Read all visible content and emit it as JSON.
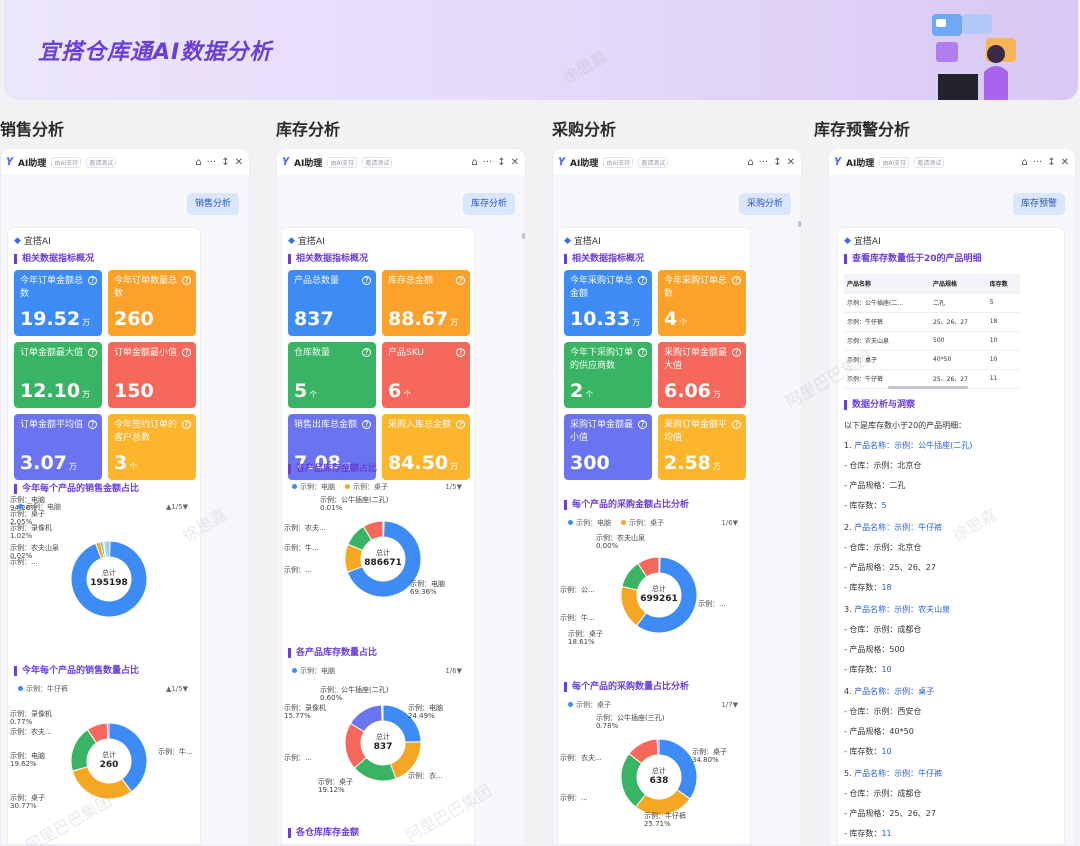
{
  "banner": {
    "title": "宜搭仓库通AI数据分析"
  },
  "watermarks": [
    "徐思嘉",
    "阿里巴巴集团"
  ],
  "assistant": {
    "name": "AI助理",
    "tag1": "由AI支持",
    "tag2": "邀请测试",
    "brand": "宜搭AI"
  },
  "sales": {
    "section_title": "销售分析",
    "prompt": "销售分析",
    "heading": "相关数据指标概况",
    "tiles": [
      {
        "label": "今年订单金额总数",
        "value": "19.52",
        "unit": "万",
        "color": "blue"
      },
      {
        "label": "今年订单数量总数",
        "value": "260",
        "unit": "",
        "color": "orange"
      },
      {
        "label": "订单金额最大值",
        "value": "12.10",
        "unit": "万",
        "color": "green"
      },
      {
        "label": "订单金额最小值",
        "value": "150",
        "unit": "",
        "color": "red"
      },
      {
        "label": "订单金额平均值",
        "value": "3.07",
        "unit": "万",
        "color": "purple"
      },
      {
        "label": "今年签约订单的客户总数",
        "value": "3",
        "unit": "个",
        "color": "amber"
      }
    ],
    "chart1": {
      "title": "今年每个产品的销售金额占比",
      "legend": "示例：电脑",
      "pager": "▲1/5▼",
      "center_label": "总计",
      "center_value": "195198"
    },
    "chart2": {
      "title": "今年每个产品的销售数量占比",
      "legend": "示例：牛仔裤",
      "pager": "▲1/5▼",
      "center_label": "总计",
      "center_value": "260"
    }
  },
  "inventory": {
    "section_title": "库存分析",
    "prompt": "库存分析",
    "heading": "相关数据指标概况",
    "tiles": [
      {
        "label": "产品总数量",
        "value": "837",
        "unit": "",
        "color": "blue"
      },
      {
        "label": "库存总金额",
        "value": "88.67",
        "unit": "万",
        "color": "orange"
      },
      {
        "label": "仓库数量",
        "value": "5",
        "unit": "个",
        "color": "green"
      },
      {
        "label": "产品SKU",
        "value": "6",
        "unit": "个",
        "color": "red"
      },
      {
        "label": "销售出库总金额",
        "value": "7.08",
        "unit": "万",
        "color": "purple"
      },
      {
        "label": "采购入库总金额",
        "value": "84.50",
        "unit": "万",
        "color": "amber"
      }
    ],
    "chart1": {
      "title": "各产品库存金额占比",
      "legend1": "示例：电脑",
      "legend2": "示例：桌子",
      "pager": "1/5▼",
      "center_label": "总计",
      "center_value": "886671"
    },
    "chart2": {
      "title": "各产品库存数量占比",
      "legend": "示例：电脑",
      "pager": "1/6▼",
      "center_label": "总计",
      "center_value": "837"
    },
    "chart3": {
      "title": "各仓库库存金额"
    }
  },
  "purchase": {
    "section_title": "采购分析",
    "prompt": "采购分析",
    "heading": "相关数据指标概况",
    "tiles": [
      {
        "label": "今年采购订单总金额",
        "value": "10.33",
        "unit": "万",
        "color": "blue"
      },
      {
        "label": "今年采购订单总数",
        "value": "4",
        "unit": "个",
        "color": "orange"
      },
      {
        "label": "今年下采购订单的供应商数",
        "value": "2",
        "unit": "个",
        "color": "green"
      },
      {
        "label": "采购订单金额最大值",
        "value": "6.06",
        "unit": "万",
        "color": "red"
      },
      {
        "label": "采购订单金额最小值",
        "value": "300",
        "unit": "",
        "color": "purple"
      },
      {
        "label": "采购订单金额平均值",
        "value": "2.58",
        "unit": "万",
        "color": "amber"
      }
    ],
    "chart1": {
      "title": "每个产品的采购金额占比分析",
      "legend1": "示例：电脑",
      "legend2": "示例：桌子",
      "pager": "1/6▼",
      "center_label": "总计",
      "center_value": "699261"
    },
    "chart2": {
      "title": "每个产品的采购数量占比分析",
      "legend": "示例：桌子",
      "pager": "1/7▼",
      "center_label": "总计",
      "center_value": "638"
    }
  },
  "alert": {
    "section_title": "库存预警分析",
    "prompt": "库存预警",
    "heading1": "查看库存数量低于20的产品明细",
    "columns": [
      "产品名称",
      "产品规格",
      "库存数"
    ],
    "rows": [
      [
        "示例：公牛插座(二...",
        "二孔",
        "5"
      ],
      [
        "示例：牛仔裤",
        "25、26、27",
        "18"
      ],
      [
        "示例：农夫山泉",
        "500",
        "10"
      ],
      [
        "示例：桌子",
        "40*50",
        "10"
      ],
      [
        "示例：牛仔裤",
        "25、26、27",
        "11"
      ]
    ],
    "heading2": "数据分析与洞察",
    "intro": "以下是库存数小于20的产品明细：",
    "items": [
      {
        "n": "1.",
        "name": "产品名称：示例：公牛插座(二孔)",
        "wh": "- 仓库：示例：北京仓",
        "spec": "- 产品规格：二孔",
        "qtyl": "- 库存数：",
        "qty": "5"
      },
      {
        "n": "2.",
        "name": "产品名称：示例：牛仔裤",
        "wh": "- 仓库：示例：北京仓",
        "spec": "- 产品规格：25、26、27",
        "qtyl": "- 库存数：",
        "qty": "18"
      },
      {
        "n": "3.",
        "name": "产品名称：示例：农夫山泉",
        "wh": "- 仓库：示例：成都仓",
        "spec": "- 产品规格：500",
        "qtyl": "- 库存数：",
        "qty": "10"
      },
      {
        "n": "4.",
        "name": "产品名称：示例：桌子",
        "wh": "- 仓库：示例：西安仓",
        "spec": "- 产品规格：40*50",
        "qtyl": "- 库存数：",
        "qty": "10"
      },
      {
        "n": "5.",
        "name": "产品名称：示例：牛仔裤",
        "wh": "- 仓库：示例：成都仓",
        "spec": "- 产品规格：25、26、27",
        "qtyl": "- 库存数：",
        "qty": "11"
      }
    ]
  },
  "donuts": {
    "s1": {
      "parts": [
        {
          "v": 94.26,
          "c": "#3d8bf5",
          "name": "示例：电脑",
          "pct": "94.26%"
        },
        {
          "v": 2.05,
          "c": "#f5a623",
          "name": "示例：桌子",
          "pct": "2.05%"
        },
        {
          "v": 1.02,
          "c": "#39b464",
          "name": "示例：录像机",
          "pct": "1.02%"
        },
        {
          "v": 0.02,
          "c": "#f5685b",
          "name": "示例：农夫山泉",
          "pct": "0.02%"
        },
        {
          "v": 2.65,
          "c": "#9bd0f0",
          "name": "示例：...",
          "pct": ""
        }
      ]
    },
    "s2": {
      "parts": [
        {
          "v": 40.0,
          "c": "#3d8bf5",
          "name": "示例：牛...",
          "pct": ""
        },
        {
          "v": 30.77,
          "c": "#f5a623",
          "name": "示例：桌子",
          "pct": "30.77%"
        },
        {
          "v": 19.62,
          "c": "#39b464",
          "name": "示例：电脑",
          "pct": "19.62%"
        },
        {
          "v": 8.84,
          "c": "#f5685b",
          "name": "示例：农夫...",
          "pct": ""
        },
        {
          "v": 0.77,
          "c": "#6a74f0",
          "name": "示例：录像机",
          "pct": "0.77%"
        }
      ]
    },
    "i1": {
      "parts": [
        {
          "v": 69.36,
          "c": "#3d8bf5",
          "name": "示例：电脑",
          "pct": "69.36%"
        },
        {
          "v": 12.0,
          "c": "#f5a623",
          "name": "示例：...",
          "pct": ""
        },
        {
          "v": 10.0,
          "c": "#39b464",
          "name": "示例：牛...",
          "pct": ""
        },
        {
          "v": 8.63,
          "c": "#f5685b",
          "name": "示例：农夫...",
          "pct": ""
        },
        {
          "v": 0.01,
          "c": "#6a74f0",
          "name": "示例：公牛插座(二孔)",
          "pct": "0.01%"
        }
      ]
    },
    "i2": {
      "parts": [
        {
          "v": 24.49,
          "c": "#3d8bf5",
          "name": "示例：电脑",
          "pct": "24.49%"
        },
        {
          "v": 20.0,
          "c": "#f5a623",
          "name": "示例：衣...",
          "pct": ""
        },
        {
          "v": 19.12,
          "c": "#39b464",
          "name": "示例：桌子",
          "pct": "19.12%"
        },
        {
          "v": 20.04,
          "c": "#f5685b",
          "name": "示例：...",
          "pct": ""
        },
        {
          "v": 15.77,
          "c": "#6a74f0",
          "name": "示例：录像机",
          "pct": "15.77%"
        },
        {
          "v": 0.6,
          "c": "#9bd0f0",
          "name": "示例：公牛插座(二孔)",
          "pct": "0.60%"
        }
      ]
    },
    "p1": {
      "parts": [
        {
          "v": 60.0,
          "c": "#3d8bf5",
          "name": "示例：...",
          "pct": ""
        },
        {
          "v": 18.61,
          "c": "#f5a623",
          "name": "示例：桌子",
          "pct": "18.61%"
        },
        {
          "v": 12.0,
          "c": "#39b464",
          "name": "示例：牛...",
          "pct": ""
        },
        {
          "v": 9.39,
          "c": "#f5685b",
          "name": "示例：公...",
          "pct": ""
        },
        {
          "v": 0.01,
          "c": "#6a74f0",
          "name": "示例：农夫山泉",
          "pct": "0.00%"
        }
      ]
    },
    "p2": {
      "parts": [
        {
          "v": 34.8,
          "c": "#3d8bf5",
          "name": "示例：桌子",
          "pct": "34.80%"
        },
        {
          "v": 25.71,
          "c": "#f5a623",
          "name": "示例：牛仔裤",
          "pct": "25.71%"
        },
        {
          "v": 25.0,
          "c": "#39b464",
          "name": "示例：...",
          "pct": ""
        },
        {
          "v": 13.71,
          "c": "#f5685b",
          "name": "示例：衣夫...",
          "pct": ""
        },
        {
          "v": 0.78,
          "c": "#6a74f0",
          "name": "示例：公牛插座(三孔)",
          "pct": "0.78%"
        }
      ]
    }
  }
}
